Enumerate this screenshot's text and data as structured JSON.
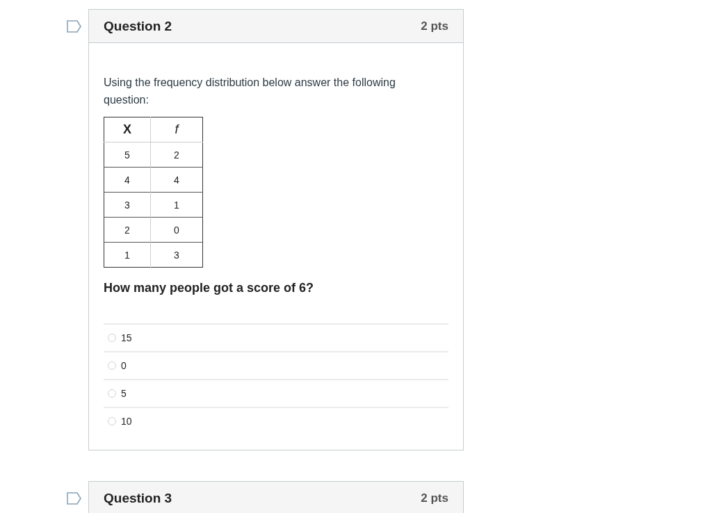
{
  "questions": [
    {
      "title": "Question 2",
      "points": "2 pts",
      "flagged": false,
      "prompt": "Using the frequency distribution below answer the following question:",
      "table": {
        "columns": [
          "X",
          "f"
        ],
        "rows": [
          [
            "5",
            "2"
          ],
          [
            "4",
            "4"
          ],
          [
            "3",
            "1"
          ],
          [
            "2",
            "0"
          ],
          [
            "1",
            "3"
          ]
        ]
      },
      "question": "How many people got a score of 6?",
      "answers": [
        {
          "label": "15",
          "selected": false
        },
        {
          "label": "0",
          "selected": false
        },
        {
          "label": "5",
          "selected": false
        },
        {
          "label": "10",
          "selected": false
        }
      ]
    },
    {
      "title": "Question 3",
      "points": "2 pts",
      "flagged": false
    }
  ]
}
